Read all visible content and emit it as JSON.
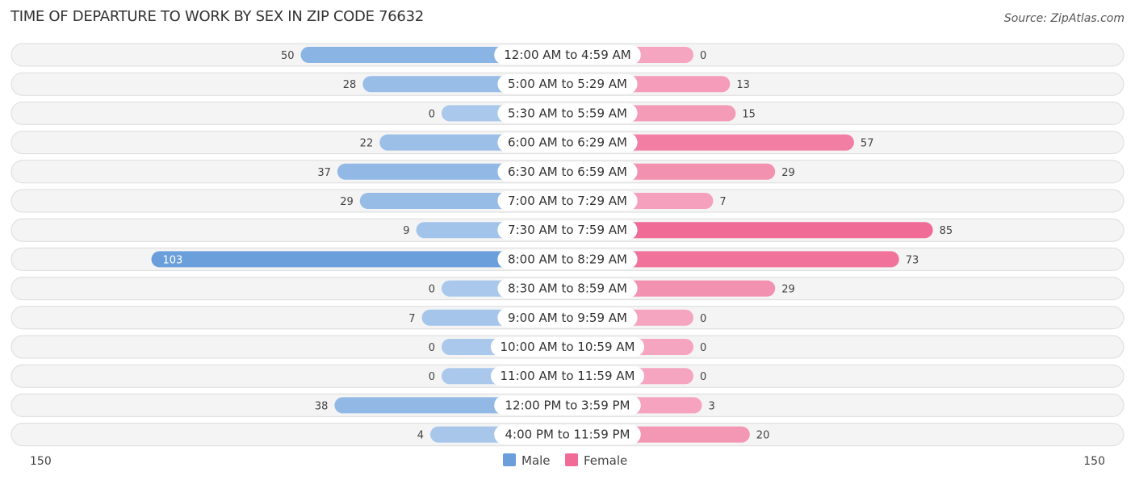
{
  "header": {
    "title": "TIME OF DEPARTURE TO WORK BY SEX IN ZIP CODE 76632",
    "source": "Source: ZipAtlas.com"
  },
  "colors": {
    "male": "#6a9fdb",
    "male_light": "#a9c8eb",
    "female": "#f06b96",
    "female_light": "#f5a5bf"
  },
  "chart_data": {
    "type": "bar",
    "orientation": "horizontal-diverging",
    "title": "TIME OF DEPARTURE TO WORK BY SEX IN ZIP CODE 76632",
    "categories": [
      "12:00 AM to 4:59 AM",
      "5:00 AM to 5:29 AM",
      "5:30 AM to 5:59 AM",
      "6:00 AM to 6:29 AM",
      "6:30 AM to 6:59 AM",
      "7:00 AM to 7:29 AM",
      "7:30 AM to 7:59 AM",
      "8:00 AM to 8:29 AM",
      "8:30 AM to 8:59 AM",
      "9:00 AM to 9:59 AM",
      "10:00 AM to 10:59 AM",
      "11:00 AM to 11:59 AM",
      "12:00 PM to 3:59 PM",
      "4:00 PM to 11:59 PM"
    ],
    "series": [
      {
        "name": "Male",
        "values": [
          50,
          28,
          0,
          22,
          37,
          29,
          9,
          103,
          0,
          7,
          0,
          0,
          38,
          4
        ]
      },
      {
        "name": "Female",
        "values": [
          0,
          13,
          15,
          57,
          29,
          7,
          85,
          73,
          29,
          0,
          0,
          0,
          3,
          20
        ]
      }
    ],
    "xlim": [
      -150,
      150
    ],
    "axis_labels": {
      "left": "150",
      "right": "150"
    },
    "legend": {
      "position": "bottom-center",
      "entries": [
        "Male",
        "Female"
      ]
    },
    "grid": false
  }
}
